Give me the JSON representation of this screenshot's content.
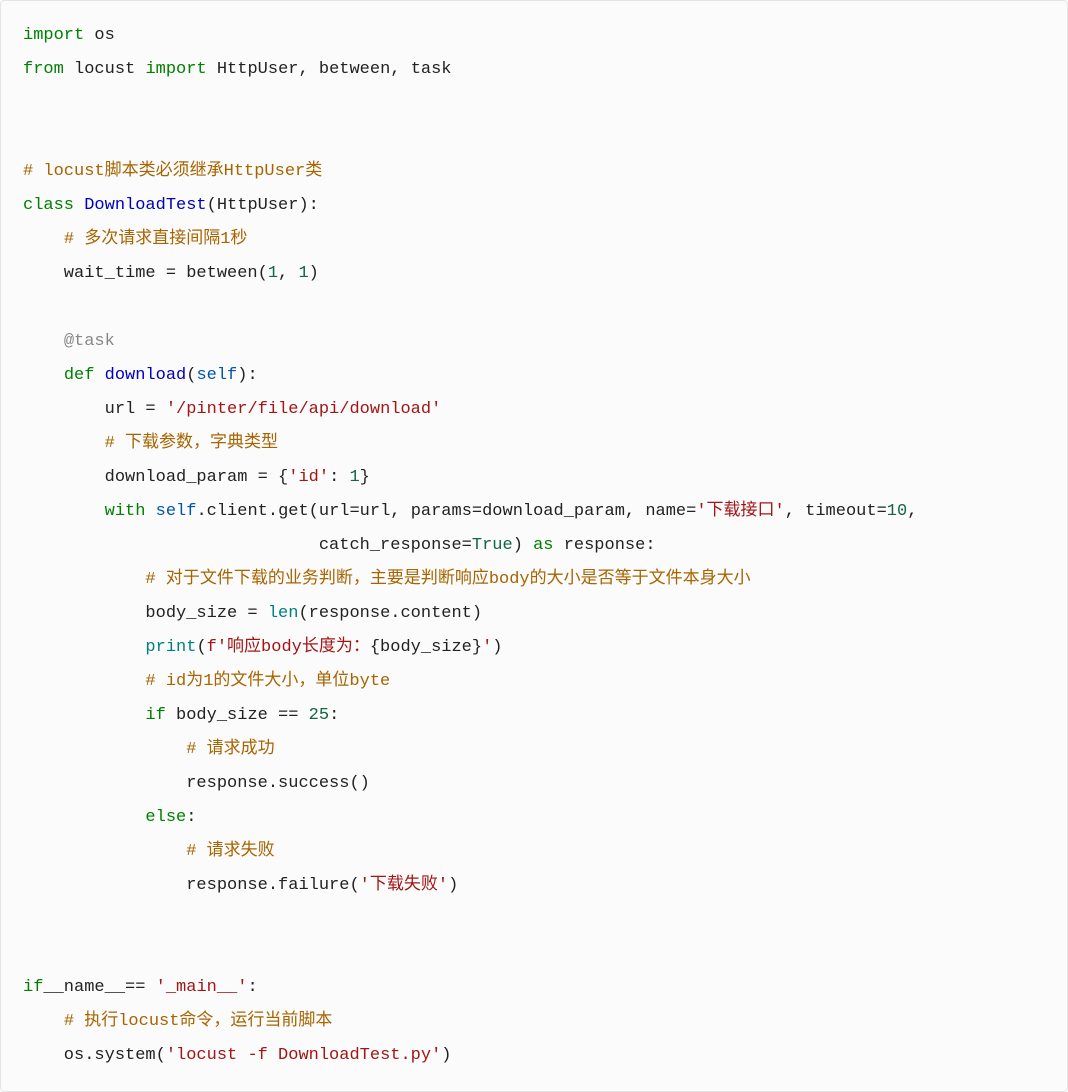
{
  "tokens": {
    "t1": "import",
    "t2": " os",
    "t3": "from",
    "t4": " locust ",
    "t5": "import",
    "t6": " HttpUser, between, task",
    "t7": "# locust脚本类必须继承HttpUser类",
    "t8": "class",
    "t9": " ",
    "t10": "DownloadTest",
    "t11": "(HttpUser):",
    "t12": "    ",
    "t13": "# 多次请求直接间隔1秒",
    "t14": "    wait_time = between(",
    "t15": "1",
    "t16": ", ",
    "t17": "1",
    "t18": ")",
    "t19": "    ",
    "t20": "@task",
    "t21": "    ",
    "t22": "def",
    "t23": " ",
    "t24": "download",
    "t25": "(",
    "t26": "self",
    "t27": "):",
    "t28": "        url = ",
    "t29": "'/pinter/file/api/download'",
    "t30": "        ",
    "t31": "# 下载参数，字典类型",
    "t32": "        download_param = {",
    "t33": "'id'",
    "t34": ": ",
    "t35": "1",
    "t36": "}",
    "t37": "        ",
    "t38": "with",
    "t39": " ",
    "t40": "self",
    "t41": ".client.get(url=url, params=download_param, name=",
    "t42": "'下载接口'",
    "t43": ", timeout=",
    "t44": "10",
    "t45": ",",
    "t46": "                             catch_response=",
    "t47": "True",
    "t48": ") ",
    "t49": "as",
    "t50": " response:",
    "t51": "            ",
    "t52": "# 对于文件下载的业务判断，主要是判断响应body的大小是否等于文件本身大小",
    "t53": "            body_size = ",
    "t54": "len",
    "t55": "(response.content)",
    "t56": "            ",
    "t57": "print",
    "t58": "(",
    "t59": "f'响应body长度为：",
    "t60": "{body_size}",
    "t61": "'",
    "t62": ")",
    "t63": "            ",
    "t64": "# id为1的文件大小，单位byte",
    "t65": "            ",
    "t66": "if",
    "t67": " body_size == ",
    "t68": "25",
    "t69": ":",
    "t70": "                ",
    "t71": "# 请求成功",
    "t72": "                response.success()",
    "t73": "            ",
    "t74": "else",
    "t75": ":",
    "t76": "                ",
    "t77": "# 请求失败",
    "t78": "                response.failure(",
    "t79": "'下载失败'",
    "t80": ")",
    "t81": "if",
    "t82": "__name__",
    "t83": "== ",
    "t84": "'_main__'",
    "t85": ":",
    "t86": "    ",
    "t87": "# 执行locust命令，运行当前脚本",
    "t88": "    os.system(",
    "t89": "'locust -f DownloadTest.py'",
    "t90": ")"
  }
}
